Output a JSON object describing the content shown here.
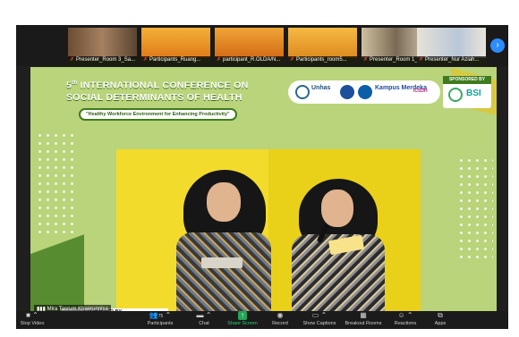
{
  "thumbnails": [
    {
      "label": "Presenter_Room 3_Sa...",
      "color": "#8a6a4a"
    },
    {
      "label": "Participants_Ruang...",
      "color": "#e58a1c"
    },
    {
      "label": "participant_R.OLDA/N...",
      "color": "#d9731a"
    },
    {
      "label": "Participants_room5...",
      "color": "#e09a20"
    },
    {
      "label": "Presenter_Room 1_D...",
      "color": "#b8a27a"
    },
    {
      "label": "Presenter_Nur Aziah...",
      "color": "#d8d2c8"
    }
  ],
  "slide": {
    "edition": "5",
    "edition_suffix": "th",
    "title_line1": "INTERNATIONAL CONFERENCE ON",
    "title_line2": "SOCIAL DETERMINANTS OF HEALTH",
    "theme": "\"Healthy Workforce Environment for Enhancing Productivity\"",
    "partner_unhas": "Unhas",
    "partner_kampus": "Kampus Merdeka",
    "partner_icsdh": "ICSDH",
    "sponsor_label": "SPONSORED BY",
    "sponsor_bank": "BSI",
    "cohosted": "CO-HOSTED BY"
  },
  "speaker_tag": "Mira Tasrum Khaerunnisa",
  "toolbar": {
    "video": "Stop Video",
    "participants": "Participants",
    "participant_count": "75",
    "chat": "Chat",
    "share": "Share Screen",
    "record": "Record",
    "captions": "Show Captions",
    "breakout": "Breakout Rooms",
    "reactions": "Reactions",
    "apps": "Apps"
  },
  "colors": {
    "slide_bg": "#b9d47a",
    "stage": "#f2d81a",
    "brand_green": "#3f7a1e",
    "share_green": "#23a558",
    "zoom_blue": "#2d8cff"
  }
}
